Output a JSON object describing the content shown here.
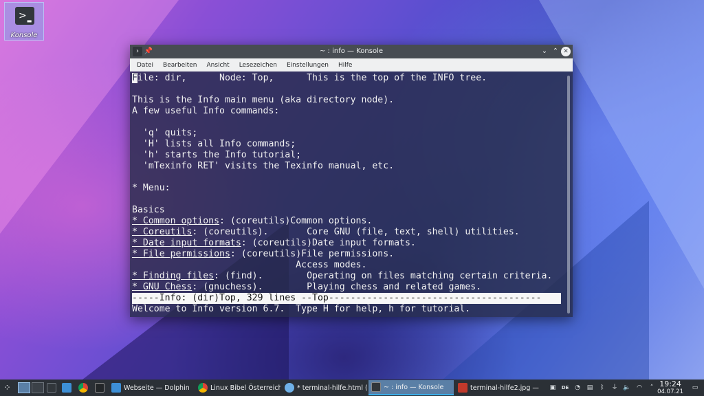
{
  "desktop": {
    "icon_label": "Konsole"
  },
  "window": {
    "title": "~ : info — Konsole",
    "menu": [
      "Datei",
      "Bearbeiten",
      "Ansicht",
      "Lesezeichen",
      "Einstellungen",
      "Hilfe"
    ],
    "terminal": {
      "cursor_char": "F",
      "lines": {
        "l1_rest": "ile: dir,      Node: Top,      This is the top of the INFO tree.",
        "l3": "This is the Info main menu (aka directory node).",
        "l4": "A few useful Info commands:",
        "l6": "  'q' quits;",
        "l7": "  'H' lists all Info commands;",
        "l8": "  'h' starts the Info tutorial;",
        "l9": "  'mTexinfo RET' visits the Texinfo manual, etc.",
        "l11": "* Menu:",
        "l13": "Basics",
        "l14_link": "* Common options",
        "l14_rest": ": (coreutils)Common options.",
        "l15_link": "* Coreutils",
        "l15_rest": ": (coreutils).       Core GNU (file, text, shell) utilities.",
        "l16_link": "* Date input formats",
        "l16_rest": ": (coreutils)Date input formats.",
        "l17_link": "* File permissions",
        "l17_rest": ": (coreutils)File permissions.",
        "l18": "                              Access modes.",
        "l19_link": "* Finding files",
        "l19_rest": ": (find).        Operating on files matching certain criteria.",
        "l20_link": "* GNU Chess",
        "l20_rest": ": (gnuchess).        Playing chess and related games.",
        "status": "-----Info: (dir)Top, 329 lines --Top---------------------------------------",
        "echo": "Welcome to Info version 6.7.  Type H for help, h for tutorial."
      }
    }
  },
  "taskbar": {
    "tasks": [
      {
        "label": "Webseite — Dolphin",
        "color": "#3d8fd6"
      },
      {
        "label": "Linux Bibel Österreich...",
        "color": "#e0a43a"
      },
      {
        "label": "* terminal-hilfe.html (...",
        "color": "#6fb1e8"
      },
      {
        "label": "~ : info — Konsole",
        "color": "#31363b"
      },
      {
        "label": "terminal-hilfe2.jpg — ...",
        "color": "#c0392b"
      }
    ],
    "keyboard_layout": "DE",
    "time": "19:24",
    "date": "04.07.21"
  }
}
